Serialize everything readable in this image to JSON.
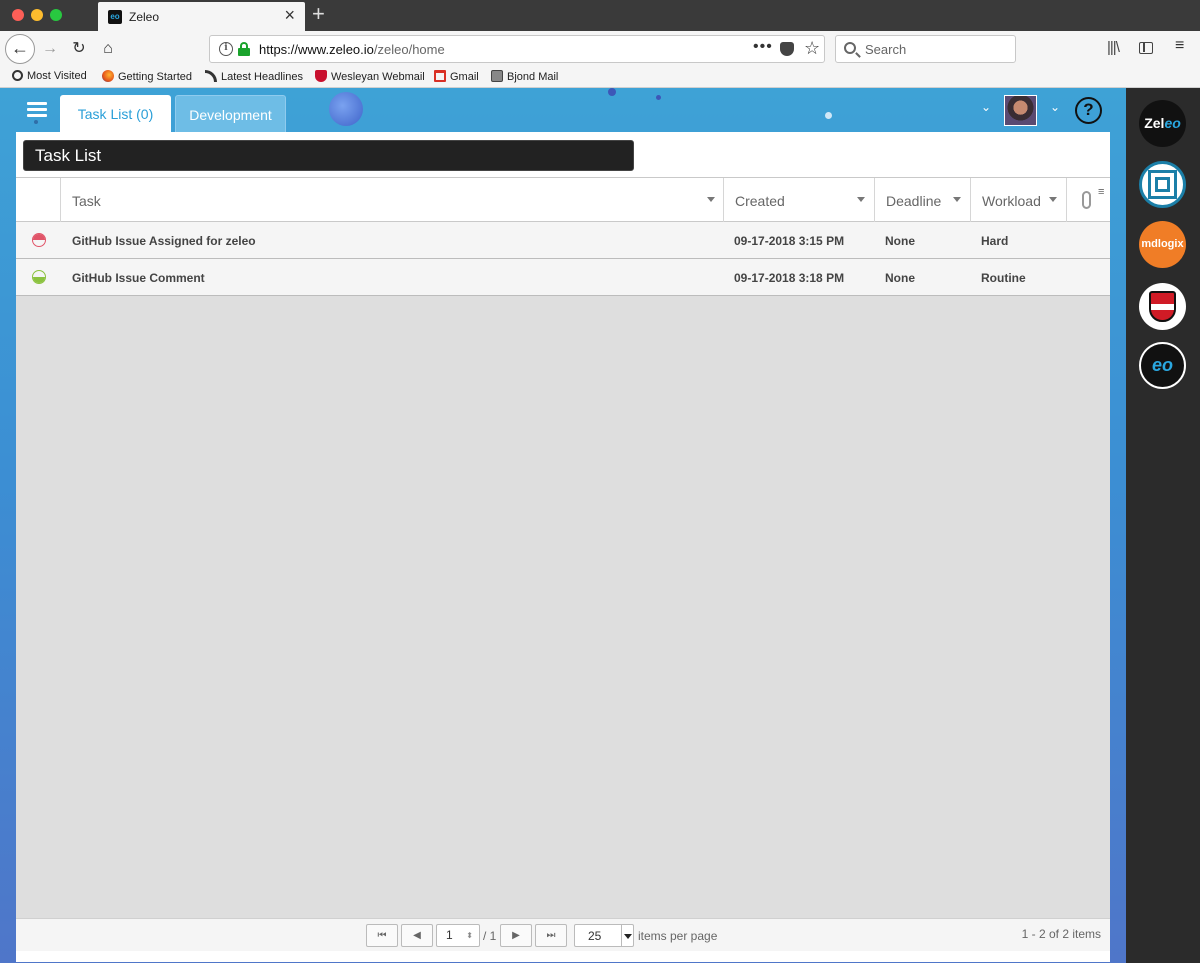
{
  "browser": {
    "tab_title": "Zeleo",
    "tab_favicon_text": "eo",
    "url_host": "https://www.zeleo.io",
    "url_path": "/zeleo/home",
    "search_placeholder": "Search",
    "icons": {
      "back": "←",
      "forward": "→",
      "reload": "↻",
      "home": "⌂",
      "close_tab": "×",
      "new_tab": "+",
      "page_actions": "•••",
      "bookmark": "☆",
      "library": "|||\\",
      "menu": "≡"
    },
    "bookmarks": [
      {
        "label": "Most Visited",
        "icon": "gear-icon"
      },
      {
        "label": "Getting Started",
        "icon": "firefox-icon"
      },
      {
        "label": "Latest Headlines",
        "icon": "rss-icon"
      },
      {
        "label": "Wesleyan Webmail",
        "icon": "wesleyan-shield-icon"
      },
      {
        "label": "Gmail",
        "icon": "gmail-icon"
      },
      {
        "label": "Bjond Mail",
        "icon": "bjond-icon"
      }
    ]
  },
  "app": {
    "tabs": [
      {
        "label": "Task List (0)",
        "active": true
      },
      {
        "label": "Development",
        "active": false
      }
    ],
    "header_icons": {
      "chevron": "⌄",
      "help": "?"
    },
    "panel_title": "Task List",
    "columns": [
      "Task",
      "Created",
      "Deadline",
      "Workload"
    ],
    "grid_menu_icon": "≡",
    "rows": [
      {
        "status": "red",
        "task": "GitHub Issue Assigned for zeleo",
        "created": "09-17-2018 3:15 PM",
        "deadline": "None",
        "workload": "Hard"
      },
      {
        "status": "green",
        "task": "GitHub Issue Comment",
        "created": "09-17-2018 3:18 PM",
        "deadline": "None",
        "workload": "Routine"
      }
    ],
    "pager": {
      "first": "⏮",
      "prev": "◀",
      "next": "▶",
      "last": "⏭",
      "current_page": "1",
      "total_pages": "/ 1",
      "page_size": "25",
      "items_per_page_label": "items per page",
      "summary": "1 - 2 of 2 items"
    }
  },
  "dock": {
    "zeleo_text": "Zel",
    "zeleo_accent": "eo",
    "mdlogix_text": "mdlogix",
    "eo_text": "eo"
  },
  "colors": {
    "accent": "#2a9fd8",
    "status_red": "#e05468",
    "status_green": "#8bc23f",
    "mdlogix_orange": "#f07d26"
  }
}
